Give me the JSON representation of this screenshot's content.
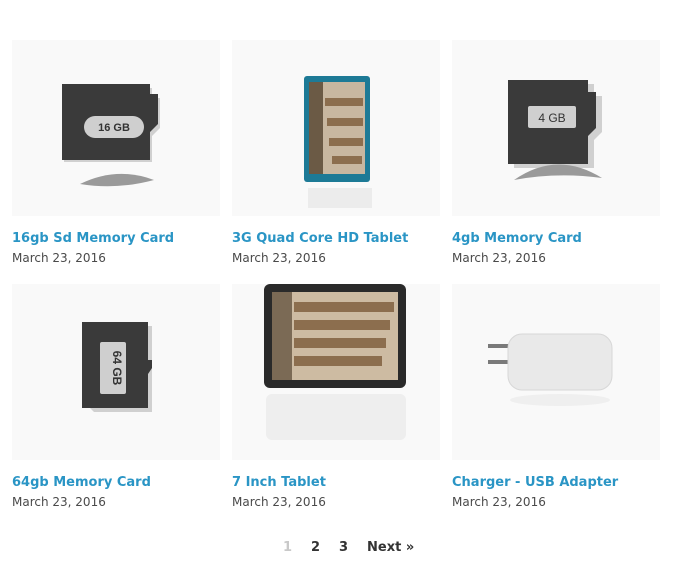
{
  "products": [
    {
      "title": "16gb Sd Memory Card",
      "date": "March 23, 2016",
      "image": "microsd-card-16gb",
      "card_label": "16 GB"
    },
    {
      "title": "3G Quad Core HD Tablet",
      "date": "March 23, 2016",
      "image": "tablet-portrait"
    },
    {
      "title": "4gb Memory Card",
      "date": "March 23, 2016",
      "image": "microsd-card-4gb",
      "card_label": "4 GB"
    },
    {
      "title": "64gb Memory Card",
      "date": "March 23, 2016",
      "image": "microsd-card-64gb",
      "card_label": "64 GB"
    },
    {
      "title": "7 Inch Tablet",
      "date": "March 23, 2016",
      "image": "tablet-landscape"
    },
    {
      "title": "Charger - USB Adapter",
      "date": "March 23, 2016",
      "image": "usb-charger"
    }
  ],
  "pagination": {
    "current": "1",
    "page2": "2",
    "page3": "3",
    "next": "Next »"
  },
  "colors": {
    "link": "#2a95c5",
    "date": "#4a4a4a",
    "thumb_bg": "#f9f9f9"
  }
}
